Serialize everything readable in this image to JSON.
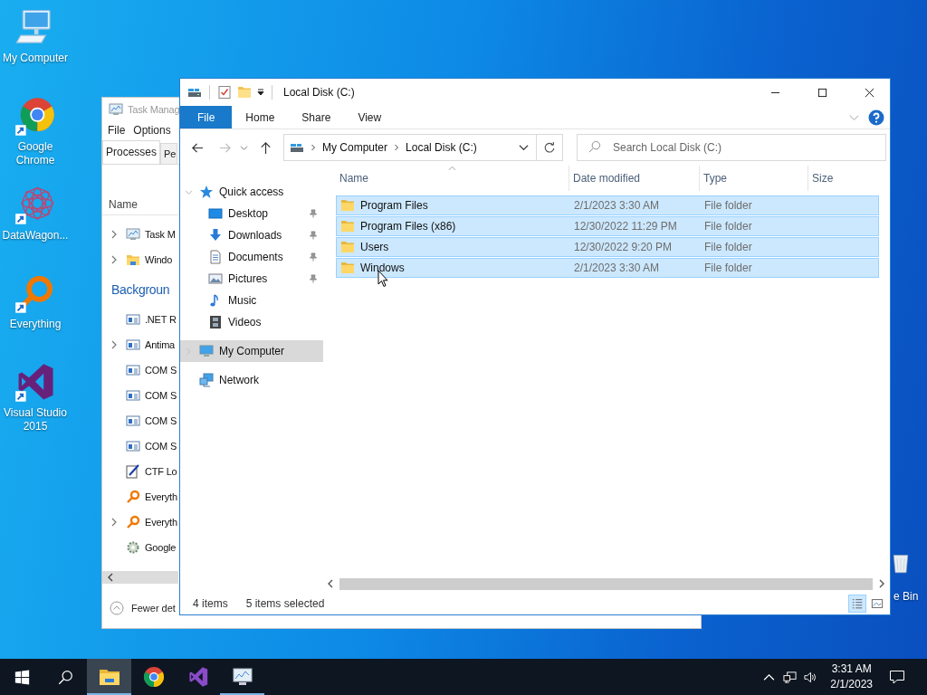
{
  "desktop_icons": [
    {
      "label": "My Computer",
      "kind": "computer",
      "shortcut": false
    },
    {
      "label": "Google Chrome",
      "kind": "chrome",
      "shortcut": true
    },
    {
      "label": "DataWagon...",
      "kind": "datawagon",
      "shortcut": true
    },
    {
      "label": "Everything",
      "kind": "everything",
      "shortcut": true
    },
    {
      "label": "Visual Studio 2015",
      "kind": "vs",
      "shortcut": true
    }
  ],
  "recycle_bin": {
    "label": "e Bin"
  },
  "task_manager": {
    "title": "Task Manag",
    "menu": [
      "File",
      "Options"
    ],
    "tabs": [
      {
        "label": "Processes",
        "selected": true
      },
      {
        "label": "Pe",
        "selected": false
      }
    ],
    "column": "Name",
    "rows": [
      {
        "kind": "taskmgr",
        "name": "Task M",
        "expandable": true
      },
      {
        "kind": "folder",
        "name": "Windo",
        "expandable": true
      },
      {
        "kind": "heading",
        "name": "Backgroun"
      },
      {
        "kind": "service",
        "name": ".NET R",
        "expandable": false
      },
      {
        "kind": "service",
        "name": "Antima",
        "expandable": true
      },
      {
        "kind": "service",
        "name": "COM S",
        "expandable": false
      },
      {
        "kind": "service",
        "name": "COM S",
        "expandable": false
      },
      {
        "kind": "service",
        "name": "COM S",
        "expandable": false
      },
      {
        "kind": "service",
        "name": "COM S",
        "expandable": false
      },
      {
        "kind": "pen",
        "name": "CTF Lo",
        "expandable": false
      },
      {
        "kind": "everything",
        "name": "Everyth",
        "expandable": false
      },
      {
        "kind": "everything",
        "name": "Everyth",
        "expandable": true
      },
      {
        "kind": "gear",
        "name": "Google",
        "expandable": false
      }
    ],
    "footer": "Fewer det"
  },
  "explorer": {
    "title": "Local Disk (C:)",
    "ribbon_tabs": [
      {
        "label": "File",
        "kind": "file"
      },
      {
        "label": "Home",
        "kind": "tab"
      },
      {
        "label": "Share",
        "kind": "tab"
      },
      {
        "label": "View",
        "kind": "tab"
      }
    ],
    "address": [
      "My Computer",
      "Local Disk (C:)"
    ],
    "search": {
      "placeholder": "Search Local Disk (C:)"
    },
    "nav": [
      {
        "label": "Quick access",
        "kind": "star",
        "expanded": true,
        "selected": false,
        "children": [
          {
            "label": "Desktop",
            "kind": "desktop",
            "pinned": true,
            "selected": false
          },
          {
            "label": "Downloads",
            "kind": "download",
            "pinned": true,
            "selected": false
          },
          {
            "label": "Documents",
            "kind": "document",
            "pinned": true,
            "selected": false
          },
          {
            "label": "Pictures",
            "kind": "pictures",
            "pinned": true,
            "selected": false
          },
          {
            "label": "Music",
            "kind": "music",
            "pinned": false,
            "selected": false
          },
          {
            "label": "Videos",
            "kind": "video",
            "pinned": false,
            "selected": false
          }
        ]
      },
      {
        "label": "My Computer",
        "kind": "computer",
        "expanded": false,
        "selected": true
      },
      {
        "label": "Network",
        "kind": "network",
        "selected": false
      }
    ],
    "columns": [
      "Name",
      "Date modified",
      "Type",
      "Size"
    ],
    "files": [
      {
        "name": "Program Files",
        "date": "2/1/2023 3:30 AM",
        "type": "File folder",
        "selected": true
      },
      {
        "name": "Program Files (x86)",
        "date": "12/30/2022 11:29 PM",
        "type": "File folder",
        "selected": true
      },
      {
        "name": "Users",
        "date": "12/30/2022 9:20 PM",
        "type": "File folder",
        "selected": true
      },
      {
        "name": "Windows",
        "date": "2/1/2023 3:30 AM",
        "type": "File folder",
        "selected": true
      }
    ],
    "status": {
      "count": "4 items",
      "selection": "5 items selected"
    },
    "views": [
      {
        "kind": "details",
        "selected": true
      },
      {
        "kind": "large",
        "selected": false
      }
    ]
  },
  "taskbar": {
    "apps": [
      {
        "kind": "explorer",
        "active": true,
        "running": true
      },
      {
        "kind": "chrome",
        "active": false,
        "running": false
      },
      {
        "kind": "vs",
        "active": false,
        "running": false
      },
      {
        "kind": "taskmgr",
        "active": false,
        "running": true
      }
    ],
    "clock": {
      "time": "3:31 AM",
      "date": "2/1/2023"
    }
  }
}
